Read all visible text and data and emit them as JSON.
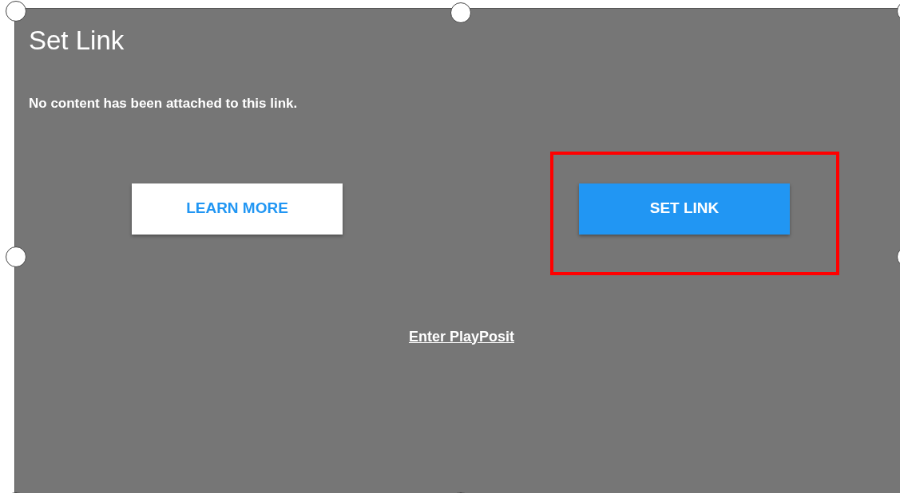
{
  "dialog": {
    "title": "Set Link",
    "message": "No content has been attached to this link."
  },
  "buttons": [
    {
      "kind": "secondary",
      "label": "LEARN MORE",
      "highlighted": false
    },
    {
      "kind": "primary",
      "label": "SET LINK",
      "highlighted": true
    }
  ],
  "link": "Enter PlayPosit"
}
